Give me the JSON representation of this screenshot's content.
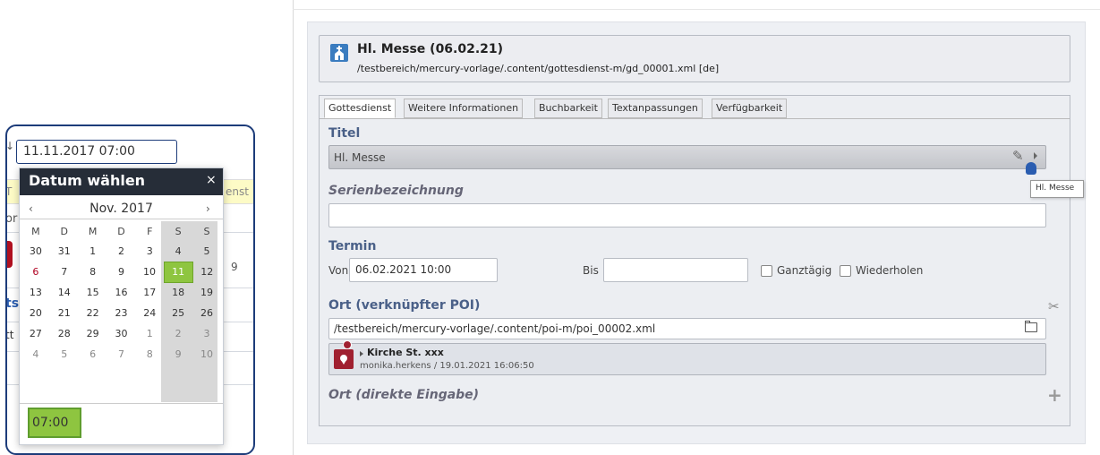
{
  "left_background": {
    "input_value": "11.11.2017 07:00",
    "left_mark": "↓",
    "yellow_left": "T",
    "yellow_right": "enst",
    "frag_or": "or",
    "frag_9": "9",
    "frag_ts": "ts",
    "frag_tt": "tt"
  },
  "datepicker": {
    "title": "Datum wählen",
    "close": "×",
    "prev": "‹",
    "next": "›",
    "month": "Nov. 2017",
    "weekdays": [
      "M",
      "D",
      "M",
      "D",
      "F",
      "S",
      "S"
    ],
    "weeks": [
      [
        "30",
        "31",
        "1",
        "2",
        "3",
        "4",
        "5"
      ],
      [
        "6",
        "7",
        "8",
        "9",
        "10",
        "11",
        "12"
      ],
      [
        "13",
        "14",
        "15",
        "16",
        "17",
        "18",
        "19"
      ],
      [
        "20",
        "21",
        "22",
        "23",
        "24",
        "25",
        "26"
      ],
      [
        "27",
        "28",
        "29",
        "30",
        "1",
        "2",
        "3"
      ],
      [
        "4",
        "5",
        "6",
        "7",
        "8",
        "9",
        "10"
      ]
    ],
    "selected_day": "11",
    "time": "07:00",
    "colors": {
      "header": "#262d38",
      "selected": "#8ec540",
      "holiday": "#b00020"
    }
  },
  "header": {
    "title": "Hl. Messe (06.02.21)",
    "path": "/testbereich/mercury-vorlage/.content/gottesdienst-m/gd_00001.xml [de]",
    "icon": "church-icon"
  },
  "tabs": [
    "Gottesdienst",
    "Weitere Informationen",
    "Buchbarkeit",
    "Textanpassungen",
    "Verfügbarkeit"
  ],
  "form": {
    "titel_label": "Titel",
    "titel_value": "Hl. Messe",
    "tooltip": "Hl. Messe",
    "serien_label": "Serienbezeichnung",
    "serien_value": "",
    "termin_label": "Termin",
    "von_label": "Von",
    "von_value": "06.02.2021 10:00",
    "bis_label": "Bis",
    "bis_value": "",
    "ganztaegig_label": "Ganztägig",
    "wiederholen_label": "Wiederholen",
    "ort_label": "Ort (verknüpfter POI)",
    "ort_value": "/testbereich/mercury-vorlage/.content/poi-m/poi_00002.xml",
    "poi_name": "Kirche St. xxx",
    "poi_meta": "monika.herkens / 19.01.2021 16:06:50",
    "ort_direkt_label": "Ort (direkte Eingabe)"
  }
}
